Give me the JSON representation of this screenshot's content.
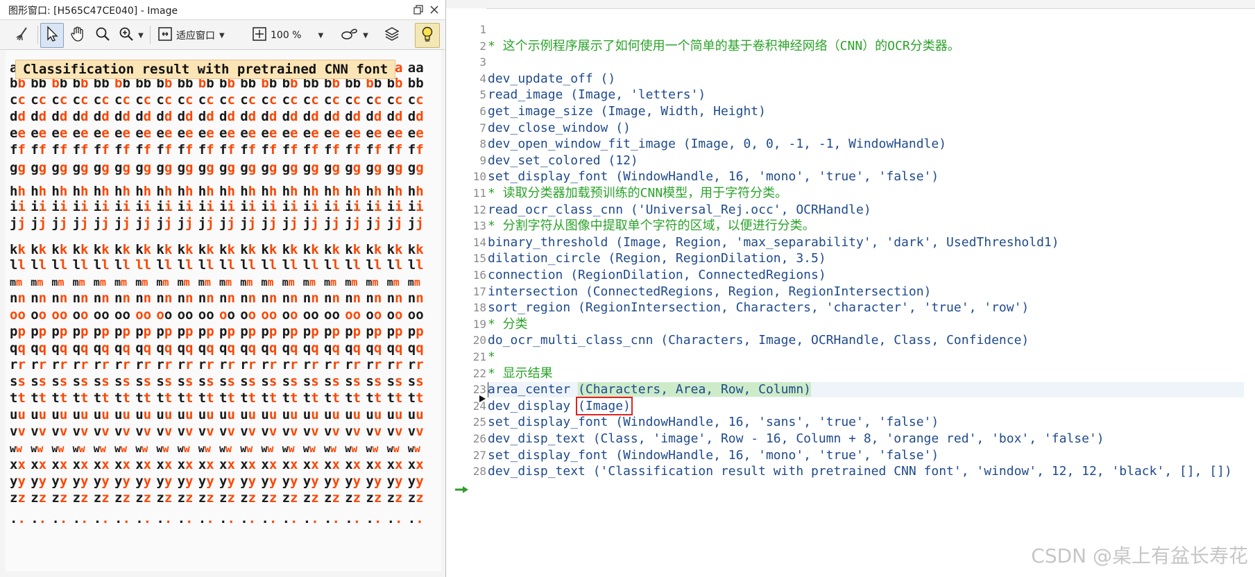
{
  "graphics_window": {
    "title": "图形窗口: [H565C47CE040] - Image",
    "toolbar": {
      "fit_label": "适应窗口",
      "zoom_label": "100 %"
    },
    "annotation": "Classification result with pretrained CNN font",
    "rows": [
      {
        "ch": "aa",
        "pattern": [
          0,
          1,
          0,
          0,
          1,
          0,
          0,
          0,
          1,
          0,
          1,
          0,
          0,
          0,
          1,
          0,
          0,
          0,
          1,
          0,
          1,
          0,
          0,
          0,
          1,
          0,
          1,
          0,
          0,
          0,
          0,
          1,
          0,
          1,
          0,
          0,
          0,
          1,
          0,
          0
        ]
      },
      {
        "ch": "bb",
        "pattern": [
          0,
          1,
          0,
          0,
          1,
          0,
          0,
          1,
          0,
          0,
          1,
          0,
          0,
          0,
          0,
          1,
          0,
          0,
          1,
          0,
          0,
          1,
          0,
          0,
          1,
          0,
          0,
          1,
          0,
          0,
          0,
          1,
          0,
          0,
          1,
          0,
          0,
          1,
          0,
          0
        ]
      },
      {
        "ch": "cc",
        "pattern": [
          0,
          1,
          0,
          1,
          0,
          1,
          0,
          1,
          0,
          1,
          0,
          1,
          0,
          1,
          0,
          1,
          0,
          1,
          0,
          1,
          0,
          1,
          0,
          1,
          0,
          1,
          0,
          1,
          0,
          1,
          0,
          1,
          0,
          1,
          0,
          1,
          0,
          1,
          0,
          1
        ]
      },
      {
        "ch": "dd",
        "pattern": [
          0,
          1,
          0,
          1,
          0,
          1,
          0,
          1,
          0,
          1,
          0,
          1,
          0,
          1,
          0,
          1,
          0,
          1,
          0,
          1,
          0,
          1,
          0,
          1,
          0,
          1,
          0,
          1,
          0,
          1,
          0,
          1,
          0,
          1,
          0,
          1,
          0,
          1,
          0,
          1
        ]
      },
      {
        "ch": "ee",
        "pattern": [
          0,
          1,
          0,
          1,
          0,
          1,
          0,
          1,
          0,
          1,
          0,
          1,
          0,
          1,
          0,
          1,
          0,
          1,
          0,
          1,
          0,
          1,
          0,
          1,
          0,
          1,
          0,
          1,
          0,
          1,
          0,
          1,
          0,
          1,
          0,
          1,
          0,
          1,
          0,
          1
        ]
      },
      {
        "ch": "ff",
        "pattern": [
          0,
          1,
          0,
          1,
          0,
          1,
          0,
          1,
          0,
          1,
          0,
          1,
          0,
          1,
          0,
          1,
          0,
          1,
          0,
          1,
          0,
          1,
          0,
          1,
          0,
          1,
          0,
          1,
          0,
          1,
          0,
          1,
          0,
          1,
          0,
          1,
          0,
          1,
          0,
          1
        ]
      },
      {
        "ch": "gg",
        "pattern": [
          0,
          1,
          0,
          1,
          0,
          1,
          0,
          1,
          0,
          1,
          0,
          1,
          0,
          1,
          0,
          1,
          0,
          1,
          0,
          1,
          0,
          1,
          0,
          1,
          0,
          1,
          0,
          1,
          0,
          1,
          0,
          1,
          0,
          1,
          0,
          1,
          0,
          1,
          0,
          1
        ]
      },
      {
        "ch": "hh",
        "pattern": [
          0,
          1,
          0,
          1,
          0,
          1,
          0,
          1,
          0,
          1,
          0,
          1,
          0,
          1,
          0,
          1,
          0,
          1,
          0,
          1,
          0,
          1,
          0,
          1,
          0,
          1,
          0,
          1,
          0,
          1,
          0,
          1,
          0,
          1,
          0,
          1,
          0,
          1,
          0,
          1
        ]
      },
      {
        "ch": "ii",
        "pattern": [
          0,
          1,
          0,
          1,
          0,
          1,
          0,
          1,
          0,
          1,
          0,
          1,
          0,
          1,
          0,
          1,
          0,
          1,
          0,
          1,
          0,
          1,
          0,
          1,
          0,
          1,
          0,
          1,
          0,
          1,
          0,
          1,
          0,
          1,
          0,
          1,
          0,
          1,
          0,
          1
        ]
      },
      {
        "ch": "jj",
        "pattern": [
          0,
          1,
          0,
          1,
          0,
          1,
          0,
          1,
          0,
          1,
          0,
          1,
          0,
          1,
          0,
          1,
          0,
          1,
          0,
          1,
          0,
          1,
          0,
          1,
          0,
          1,
          0,
          1,
          0,
          1,
          0,
          1,
          0,
          1,
          0,
          1,
          0,
          1,
          0,
          1
        ]
      },
      {
        "ch": "kk",
        "pattern": [
          0,
          1,
          0,
          1,
          0,
          1,
          0,
          1,
          0,
          1,
          0,
          1,
          0,
          1,
          0,
          1,
          0,
          1,
          0,
          1,
          0,
          1,
          0,
          1,
          0,
          1,
          0,
          1,
          0,
          1,
          0,
          1,
          0,
          1,
          0,
          1,
          0,
          1,
          0,
          1
        ]
      },
      {
        "ch": "ll",
        "pattern": [
          0,
          1,
          0,
          1,
          0,
          1,
          0,
          1,
          0,
          1,
          0,
          1,
          1,
          1,
          0,
          1,
          0,
          1,
          0,
          1,
          0,
          1,
          0,
          1,
          0,
          1,
          0,
          1,
          0,
          1,
          0,
          1,
          0,
          1,
          0,
          1,
          0,
          1,
          0,
          1
        ]
      },
      {
        "ch": "mm",
        "pattern": [
          0,
          1,
          0,
          1,
          0,
          1,
          0,
          1,
          0,
          1,
          0,
          1,
          0,
          1,
          0,
          1,
          0,
          1,
          0,
          1,
          0,
          1,
          0,
          1,
          0,
          1,
          0,
          1,
          0,
          1,
          0,
          1,
          0,
          1,
          0,
          1,
          0,
          1,
          0,
          1
        ]
      },
      {
        "ch": "nn",
        "pattern": [
          0,
          1,
          0,
          1,
          0,
          1,
          0,
          1,
          0,
          1,
          0,
          1,
          0,
          1,
          0,
          1,
          0,
          1,
          0,
          1,
          0,
          1,
          0,
          1,
          0,
          1,
          0,
          1,
          0,
          1,
          0,
          1,
          0,
          1,
          0,
          1,
          0,
          1,
          0,
          1
        ]
      },
      {
        "ch": "oo",
        "pattern": [
          1,
          1,
          0,
          1,
          1,
          1,
          0,
          1,
          0,
          0,
          0,
          0,
          1,
          1,
          1,
          0,
          0,
          0,
          0,
          0,
          1,
          0,
          0,
          1,
          1,
          1,
          0,
          1,
          0,
          0,
          0,
          0,
          1,
          1,
          0,
          1,
          0,
          1,
          0,
          0
        ]
      },
      {
        "ch": "pp",
        "pattern": [
          0,
          1,
          0,
          1,
          0,
          1,
          0,
          1,
          0,
          1,
          0,
          1,
          0,
          1,
          0,
          1,
          0,
          1,
          0,
          1,
          0,
          1,
          0,
          1,
          0,
          1,
          0,
          1,
          0,
          1,
          0,
          1,
          0,
          1,
          0,
          1,
          0,
          1,
          0,
          1
        ]
      },
      {
        "ch": "qq",
        "pattern": [
          0,
          1,
          0,
          1,
          0,
          1,
          0,
          1,
          0,
          1,
          0,
          1,
          0,
          1,
          0,
          1,
          0,
          1,
          0,
          1,
          0,
          1,
          0,
          1,
          0,
          1,
          0,
          1,
          0,
          1,
          0,
          1,
          0,
          1,
          0,
          1,
          0,
          1,
          0,
          1
        ]
      },
      {
        "ch": "rr",
        "pattern": [
          0,
          1,
          0,
          1,
          0,
          1,
          0,
          1,
          0,
          1,
          0,
          1,
          0,
          1,
          0,
          1,
          0,
          1,
          0,
          1,
          0,
          1,
          0,
          1,
          0,
          1,
          0,
          1,
          0,
          1,
          0,
          1,
          0,
          1,
          0,
          1,
          0,
          1,
          0,
          1
        ]
      },
      {
        "ch": "ss",
        "pattern": [
          0,
          1,
          0,
          1,
          0,
          1,
          0,
          1,
          0,
          1,
          0,
          1,
          0,
          1,
          0,
          1,
          0,
          1,
          0,
          1,
          0,
          1,
          0,
          1,
          0,
          1,
          0,
          1,
          0,
          1,
          0,
          1,
          0,
          1,
          0,
          1,
          0,
          1,
          0,
          1
        ]
      },
      {
        "ch": "tt",
        "pattern": [
          0,
          1,
          0,
          1,
          0,
          1,
          0,
          1,
          0,
          1,
          0,
          1,
          0,
          1,
          0,
          1,
          0,
          1,
          0,
          1,
          0,
          1,
          0,
          1,
          0,
          1,
          0,
          1,
          0,
          1,
          0,
          1,
          0,
          1,
          0,
          1,
          0,
          1,
          0,
          1
        ]
      },
      {
        "ch": "uu",
        "pattern": [
          0,
          1,
          0,
          1,
          0,
          1,
          0,
          1,
          0,
          1,
          0,
          1,
          0,
          1,
          0,
          1,
          0,
          1,
          0,
          1,
          0,
          1,
          0,
          1,
          0,
          1,
          0,
          1,
          0,
          1,
          0,
          1,
          0,
          1,
          0,
          1,
          0,
          1,
          0,
          1
        ]
      },
      {
        "ch": "vv",
        "pattern": [
          0,
          1,
          0,
          1,
          0,
          1,
          0,
          1,
          0,
          1,
          0,
          1,
          0,
          1,
          0,
          1,
          0,
          1,
          0,
          1,
          0,
          1,
          0,
          1,
          0,
          1,
          0,
          1,
          0,
          1,
          0,
          1,
          0,
          1,
          0,
          1,
          0,
          1,
          0,
          1
        ]
      },
      {
        "ch": "ww",
        "pattern": [
          0,
          1,
          0,
          1,
          0,
          1,
          0,
          1,
          0,
          1,
          0,
          1,
          0,
          1,
          0,
          1,
          0,
          1,
          0,
          1,
          0,
          1,
          0,
          1,
          0,
          1,
          0,
          1,
          0,
          1,
          0,
          1,
          0,
          1,
          0,
          1,
          0,
          1,
          0,
          1
        ]
      },
      {
        "ch": "xx",
        "pattern": [
          0,
          1,
          0,
          1,
          0,
          1,
          0,
          1,
          0,
          1,
          0,
          1,
          0,
          1,
          0,
          1,
          0,
          1,
          0,
          1,
          0,
          1,
          0,
          1,
          0,
          1,
          0,
          1,
          0,
          1,
          0,
          1,
          0,
          1,
          0,
          1,
          0,
          1,
          0,
          1
        ]
      },
      {
        "ch": "yy",
        "pattern": [
          0,
          1,
          0,
          1,
          0,
          1,
          0,
          1,
          0,
          1,
          0,
          1,
          0,
          1,
          0,
          1,
          0,
          1,
          0,
          1,
          0,
          1,
          0,
          1,
          0,
          1,
          0,
          1,
          0,
          1,
          0,
          1,
          0,
          1,
          0,
          1,
          0,
          1,
          0,
          1
        ]
      },
      {
        "ch": "zz",
        "pattern": [
          0,
          1,
          0,
          1,
          0,
          1,
          0,
          1,
          0,
          1,
          0,
          1,
          0,
          1,
          0,
          1,
          0,
          1,
          0,
          1,
          0,
          1,
          0,
          1,
          0,
          1,
          0,
          1,
          0,
          1,
          0,
          1,
          0,
          1,
          0,
          1,
          0,
          1,
          0,
          1
        ]
      },
      {
        "ch": "..",
        "pattern": [
          0,
          1,
          0,
          1,
          0,
          1,
          0,
          1,
          0,
          1,
          0,
          1,
          0,
          1,
          0,
          1,
          0,
          1,
          0,
          1,
          0,
          1,
          0,
          1,
          0,
          1,
          0,
          1,
          0,
          1,
          0,
          1,
          0,
          1,
          0,
          1,
          0,
          1,
          0,
          1
        ]
      }
    ],
    "colors": {
      "black": "#1a1a1a",
      "orange_red": "#ff4500"
    }
  },
  "editor": {
    "lines": [
      {
        "n": "1",
        "text": "",
        "kind": "code"
      },
      {
        "n": "2",
        "text": "* 这个示例程序展示了如何使用一个简单的基于卷积神经网络（CNN）的OCR分类器。",
        "kind": "cmt"
      },
      {
        "n": "3",
        "text": "",
        "kind": "code"
      },
      {
        "n": "4",
        "text": "dev_update_off ()",
        "kind": "code"
      },
      {
        "n": "5",
        "text": "read_image (Image, 'letters')",
        "kind": "code"
      },
      {
        "n": "6",
        "text": "get_image_size (Image, Width, Height)",
        "kind": "code"
      },
      {
        "n": "7",
        "text": "dev_close_window ()",
        "kind": "code"
      },
      {
        "n": "8",
        "text": "dev_open_window_fit_image (Image, 0, 0, -1, -1, WindowHandle)",
        "kind": "code"
      },
      {
        "n": "9",
        "text": "dev_set_colored (12)",
        "kind": "code"
      },
      {
        "n": "10",
        "text": "set_display_font (WindowHandle, 16, 'mono', 'true', 'false')",
        "kind": "code"
      },
      {
        "n": "11",
        "text": "* 读取分类器加载预训练的CNN模型，用于字符分类。",
        "kind": "cmt"
      },
      {
        "n": "12",
        "text": "read_ocr_class_cnn ('Universal_Rej.occ', OCRHandle)",
        "kind": "code"
      },
      {
        "n": "13",
        "text": "* 分割字符从图像中提取单个字符的区域，以便进行分类。",
        "kind": "cmt"
      },
      {
        "n": "14",
        "text": "binary_threshold (Image, Region, 'max_separability', 'dark', UsedThreshold1)",
        "kind": "code"
      },
      {
        "n": "15",
        "text": "dilation_circle (Region, RegionDilation, 3.5)",
        "kind": "code"
      },
      {
        "n": "16",
        "text": "connection (RegionDilation, ConnectedRegions)",
        "kind": "code"
      },
      {
        "n": "17",
        "text": "intersection (ConnectedRegions, Region, RegionIntersection)",
        "kind": "code"
      },
      {
        "n": "18",
        "text": "sort_region (RegionIntersection, Characters, 'character', 'true', 'row')",
        "kind": "code"
      },
      {
        "n": "19",
        "text": "* 分类",
        "kind": "cmt"
      },
      {
        "n": "20",
        "text": "do_ocr_multi_class_cnn (Characters, Image, OCRHandle, Class, Confidence)",
        "kind": "code"
      },
      {
        "n": "21",
        "text": "*",
        "kind": "cmt"
      },
      {
        "n": "22",
        "text": "* 显示结果",
        "kind": "cmt"
      },
      {
        "n": "23",
        "text": "",
        "kind": "cur",
        "pre": "area_center ",
        "paren": "(Characters, Area, Row, Column)",
        "paren_style": "hl"
      },
      {
        "n": "24",
        "text": "",
        "kind": "code",
        "pre": "dev_display ",
        "paren": "(Image)",
        "paren_style": "boxed"
      },
      {
        "n": "25",
        "text": "set_display_font (WindowHandle, 16, 'sans', 'true', 'false')",
        "kind": "code"
      },
      {
        "n": "26",
        "text": "dev_disp_text (Class, 'image', Row - 16, Column + 8, 'orange red', 'box', 'false')",
        "kind": "code"
      },
      {
        "n": "27",
        "text": "set_display_font (WindowHandle, 16, 'mono', 'true', 'false')",
        "kind": "code"
      },
      {
        "n": "28",
        "text": "dev_disp_text ('Classification result with pretrained CNN font', 'window', 12, 12, 'black', [], [])",
        "kind": "code"
      }
    ]
  },
  "watermark": "CSDN @桌上有盆长寿花"
}
